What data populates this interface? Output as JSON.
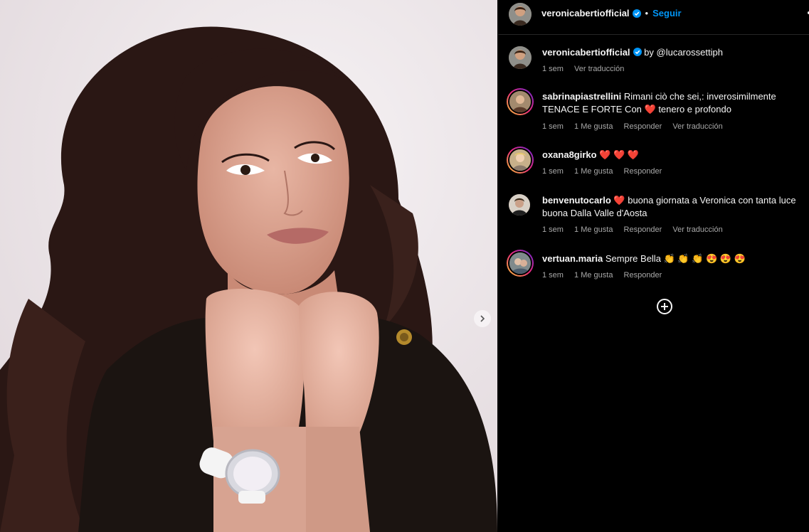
{
  "post": {
    "author": "veronicabertiofficial",
    "follow_label": "Seguir",
    "dot": "•",
    "caption_credit": "by @lucarossettiph",
    "caption_time": "1 sem",
    "caption_translate": "Ver traducción"
  },
  "comments": [
    {
      "username": "sabrinapiastrellini",
      "text_before": "Rimani ciò che sei,: inverosimilmente TENACE E FORTE Con ",
      "emoji": "❤️",
      "text_after": " tenero e profondo",
      "time": "1 sem",
      "likes": "1 Me gusta",
      "reply": "Responder",
      "translate": "Ver traducción"
    },
    {
      "username": "oxana8girko",
      "emoji": "❤️ ❤️ ❤️",
      "time": "1 sem",
      "likes": "1 Me gusta",
      "reply": "Responder"
    },
    {
      "username": "benvenutocarlo",
      "emoji": "❤️",
      "text_after": " buona giornata a Veronica con tanta luce buona Dalla Valle d'Aosta",
      "time": "1 sem",
      "likes": "1 Me gusta",
      "reply": "Responder",
      "translate": "Ver traducción"
    },
    {
      "username": "vertuan.maria",
      "text_before": "Sempre Bella",
      "emoji": "👏 👏 👏 😍 😍 😍",
      "time": "1 sem",
      "likes": "1 Me gusta",
      "reply": "Responder"
    }
  ],
  "icons": {
    "next": "chevron-right-icon",
    "add": "plus-circle-icon",
    "verified": "verified-badge-icon"
  },
  "colors": {
    "accent": "#0095f6",
    "background": "#000000",
    "secondary_text": "#a8a8a8",
    "heart": "#ff3040"
  }
}
